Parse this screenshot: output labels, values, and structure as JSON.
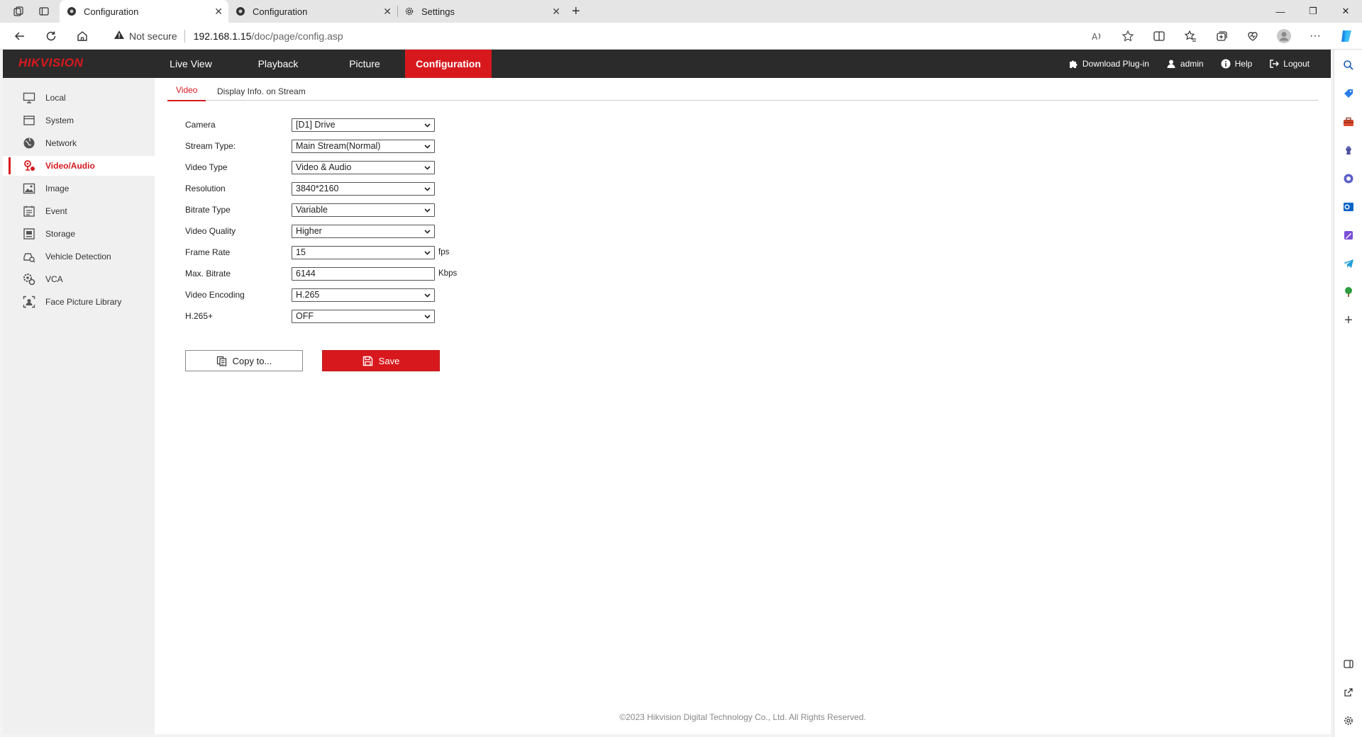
{
  "browser": {
    "tabs": [
      {
        "title": "Configuration",
        "active": true
      },
      {
        "title": "Configuration",
        "active": false
      },
      {
        "title": "Settings",
        "active": false
      }
    ],
    "security_label": "Not secure",
    "url_host": "192.168.1.15",
    "url_path": "/doc/page/config.asp"
  },
  "header": {
    "logo": "HIKVISION",
    "nav": [
      "Live View",
      "Playback",
      "Picture",
      "Configuration"
    ],
    "active_nav": "Configuration",
    "download_plugin": "Download Plug-in",
    "user": "admin",
    "help": "Help",
    "logout": "Logout"
  },
  "sidebar": {
    "items": [
      "Local",
      "System",
      "Network",
      "Video/Audio",
      "Image",
      "Event",
      "Storage",
      "Vehicle Detection",
      "VCA",
      "Face Picture Library"
    ],
    "active": "Video/Audio"
  },
  "subtabs": [
    "Video",
    "Display Info. on Stream"
  ],
  "form": {
    "camera": {
      "label": "Camera",
      "value": "[D1] Drive"
    },
    "stream_type": {
      "label": "Stream Type:",
      "value": "Main Stream(Normal)"
    },
    "video_type": {
      "label": "Video Type",
      "value": "Video & Audio"
    },
    "resolution": {
      "label": "Resolution",
      "value": "3840*2160"
    },
    "bitrate_type": {
      "label": "Bitrate Type",
      "value": "Variable"
    },
    "video_quality": {
      "label": "Video Quality",
      "value": "Higher"
    },
    "frame_rate": {
      "label": "Frame Rate",
      "value": "15",
      "unit": "fps"
    },
    "max_bitrate": {
      "label": "Max. Bitrate",
      "value": "6144",
      "unit": "Kbps"
    },
    "video_encoding": {
      "label": "Video Encoding",
      "value": "H.265"
    },
    "h265plus": {
      "label": "H.265+",
      "value": "OFF"
    }
  },
  "buttons": {
    "copy": "Copy to...",
    "save": "Save"
  },
  "footer": "©2023 Hikvision Digital Technology Co., Ltd. All Rights Reserved.",
  "colors": {
    "accent": "#d7191e",
    "nav_bg": "#2b2b2b"
  }
}
